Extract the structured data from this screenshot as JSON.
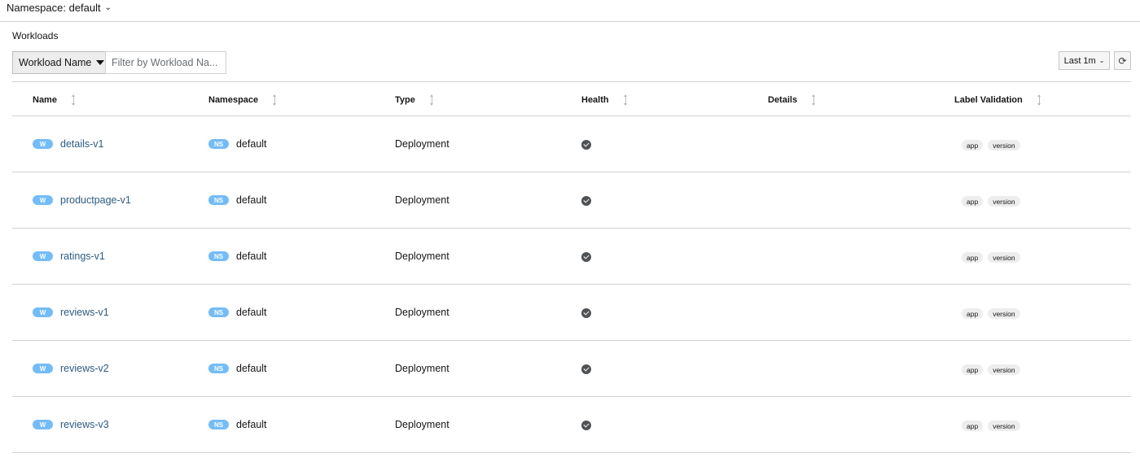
{
  "namespace_selector": {
    "label": "Namespace: default",
    "icon": "chevron-down-icon"
  },
  "page_title": "Workloads",
  "filter": {
    "type_label": "Workload Name",
    "placeholder": "Filter by Workload Na..."
  },
  "time_range": {
    "label": "Last 1m"
  },
  "refresh": {
    "icon": "refresh-icon"
  },
  "table": {
    "columns": [
      "Name",
      "Namespace",
      "Type",
      "Health",
      "Details",
      "Label Validation"
    ],
    "rows": [
      {
        "badge": "W",
        "name": "details-v1",
        "ns_badge": "NS",
        "namespace": "default",
        "type": "Deployment",
        "health": "healthy",
        "labels": [
          "app",
          "version"
        ]
      },
      {
        "badge": "W",
        "name": "productpage-v1",
        "ns_badge": "NS",
        "namespace": "default",
        "type": "Deployment",
        "health": "healthy",
        "labels": [
          "app",
          "version"
        ]
      },
      {
        "badge": "W",
        "name": "ratings-v1",
        "ns_badge": "NS",
        "namespace": "default",
        "type": "Deployment",
        "health": "healthy",
        "labels": [
          "app",
          "version"
        ]
      },
      {
        "badge": "W",
        "name": "reviews-v1",
        "ns_badge": "NS",
        "namespace": "default",
        "type": "Deployment",
        "health": "healthy",
        "labels": [
          "app",
          "version"
        ]
      },
      {
        "badge": "W",
        "name": "reviews-v2",
        "ns_badge": "NS",
        "namespace": "default",
        "type": "Deployment",
        "health": "healthy",
        "labels": [
          "app",
          "version"
        ]
      },
      {
        "badge": "W",
        "name": "reviews-v3",
        "ns_badge": "NS",
        "namespace": "default",
        "type": "Deployment",
        "health": "healthy",
        "labels": [
          "app",
          "version"
        ]
      }
    ]
  },
  "colors": {
    "badge": "#73bcf7",
    "link": "#2b5c82",
    "health_ok": "#4f5255"
  }
}
